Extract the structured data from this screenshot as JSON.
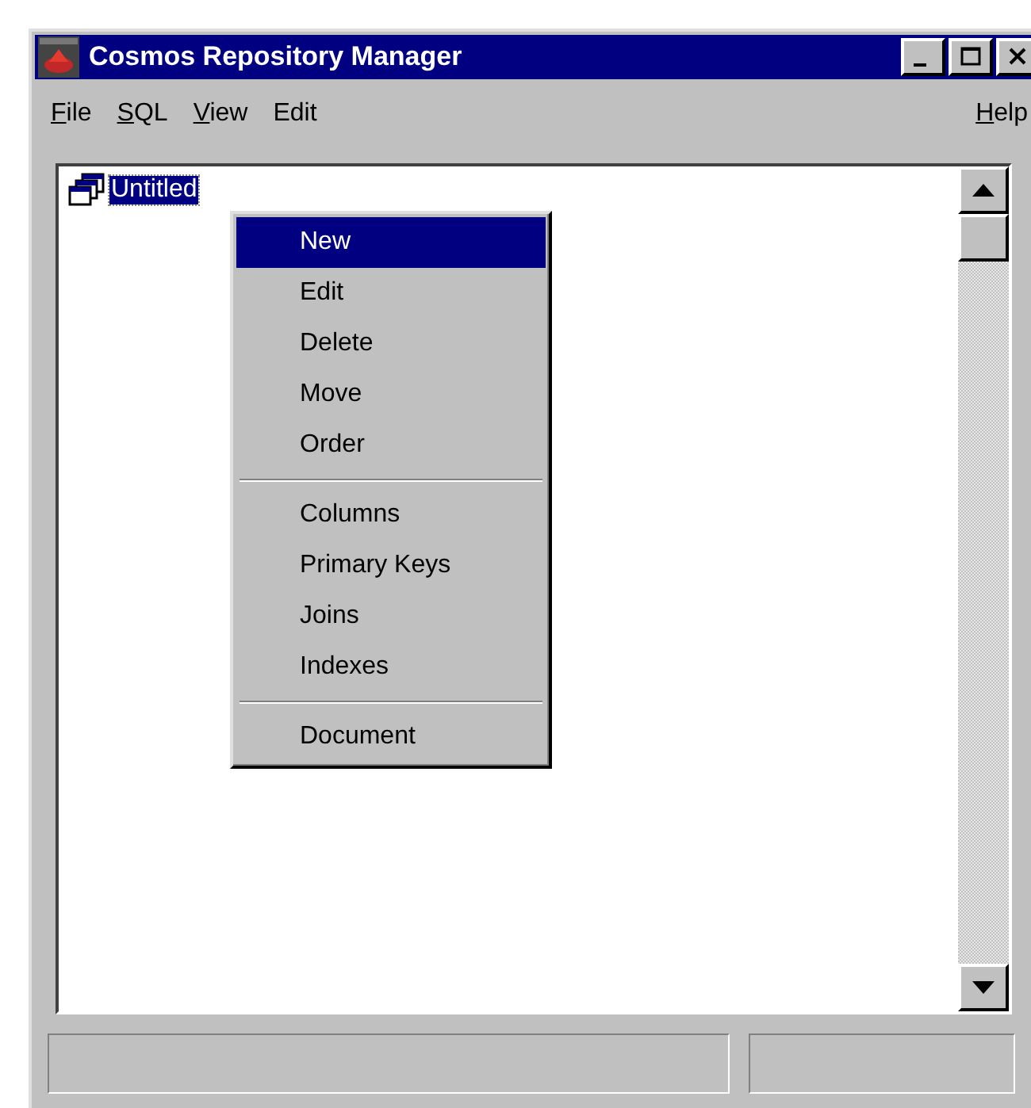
{
  "window": {
    "title": "Cosmos Repository Manager"
  },
  "menu_bar": [
    {
      "accel": "F",
      "rest": "ile"
    },
    {
      "accel": "S",
      "rest": "QL"
    },
    {
      "accel": "V",
      "rest": "iew"
    },
    {
      "label": "Edit"
    },
    {
      "accel": "H",
      "rest": "elp"
    }
  ],
  "tree": [
    {
      "label": "Untitled",
      "selected": true
    }
  ],
  "context_menu": [
    {
      "kind": "item",
      "label": "New",
      "selected": true
    },
    {
      "kind": "item",
      "label": "Edit",
      "selected": false
    },
    {
      "kind": "item",
      "label": "Delete",
      "selected": false
    },
    {
      "kind": "item",
      "label": "Move",
      "selected": false
    },
    {
      "kind": "item",
      "label": "Order",
      "selected": false
    },
    {
      "kind": "separator"
    },
    {
      "kind": "item",
      "label": "Columns",
      "selected": false
    },
    {
      "kind": "item",
      "label": "Primary Keys",
      "selected": false
    },
    {
      "kind": "item",
      "label": "Joins",
      "selected": false
    },
    {
      "kind": "item",
      "label": "Indexes",
      "selected": false
    },
    {
      "kind": "separator"
    },
    {
      "kind": "item",
      "label": "Document",
      "selected": false
    }
  ]
}
